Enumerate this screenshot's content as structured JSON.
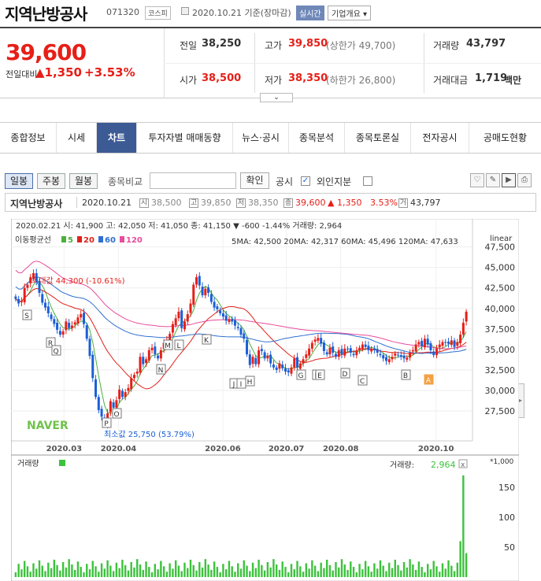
{
  "header": {
    "title": "지역난방공사",
    "code": "071320",
    "market": "코스피",
    "date_info": "2020.10.21 기준(장마감)",
    "realtime_btn": "실시간",
    "corp_btn": "기업개요 ▾"
  },
  "quote": {
    "price": "39,600",
    "prev_label": "전일대비",
    "change_amt": "▲1,350",
    "change_pct": "+3.53%",
    "prev_close_label": "전일",
    "prev_close": "38,250",
    "high_label": "고가",
    "high": "39,850",
    "upper_limit": "(상한가 49,700)",
    "volume_label": "거래량",
    "volume": "43,797",
    "open_label": "시가",
    "open": "38,500",
    "low_label": "저가",
    "low": "38,350",
    "lower_limit": "(하한가 26,800)",
    "amount_label": "거래대금",
    "amount": "1,719",
    "amount_unit": "백만"
  },
  "tabs": [
    "종합정보",
    "시세",
    "차트",
    "투자자별 매매동향",
    "뉴스·공시",
    "종목분석",
    "종목토론실",
    "전자공시",
    "공매도현황"
  ],
  "active_tab": "차트",
  "toolbar": {
    "periods": [
      "일봉",
      "주봉",
      "월봉"
    ],
    "compare_label": "종목비교",
    "ok_label": "확인",
    "disclosure_label": "공시",
    "foreign_label": "외인지분"
  },
  "summary": {
    "name": "지역난방공사",
    "date": "2020.10.21",
    "open": "38,500",
    "high": "39,850",
    "low": "38,350",
    "close": "39,600",
    "change": "▲ 1,350",
    "pct": "3.53%",
    "volume": "43,797",
    "tags": [
      "시",
      "고",
      "저",
      "종",
      "거"
    ]
  },
  "chart_info": {
    "hover_line": "2020.02.21  시: 41,900  고: 42,050  저: 41,050  종: 41,150 ▼   -600   -1.44%  거래량: 2,964",
    "ma_label": "이동평균선",
    "ma_legend": [
      "5",
      "20",
      "60",
      "120"
    ],
    "ma_values": "5MA: 42,500  20MA: 42,317  60MA: 45,496  120MA: 47,633",
    "scale": "linear",
    "max_label": "최대값 44,300 (-10.61%)",
    "min_label": "최소값 25,750 (53.79%)",
    "watermark": "NAVER",
    "volume_label": "거래량",
    "volume_value_label": "거래량:",
    "volume_value": "2,964",
    "volume_unit": "*1,000"
  },
  "colors": {
    "up": "#e61f18",
    "down": "#1a5fd8",
    "ma5": "#4caf3c",
    "ma20": "#e0221b",
    "ma60": "#2f6fd0",
    "ma120": "#e84c9c",
    "volume": "#3cc23c",
    "signal_a": "#f5a042"
  },
  "chart_data": {
    "type": "candlestick",
    "y_ticks": [
      "47,500",
      "45,000",
      "42,500",
      "40,000",
      "37,500",
      "35,000",
      "32,500",
      "30,000",
      "27,500"
    ],
    "ylim": [
      25000,
      49000
    ],
    "x_ticks": [
      "2020.03",
      "2020.04",
      "2020.06",
      "2020.07",
      "2020.08",
      "2020.10"
    ],
    "close": [
      41150,
      40600,
      40900,
      42500,
      42900,
      43800,
      44300,
      43200,
      41900,
      40700,
      40100,
      39400,
      38700,
      38100,
      37400,
      36800,
      37200,
      38400,
      37600,
      37900,
      38300,
      38900,
      39300,
      38100,
      36300,
      34200,
      31500,
      29200,
      27600,
      26800,
      25750,
      27200,
      28700,
      27900,
      28800,
      30100,
      29200,
      29800,
      30300,
      31500,
      31900,
      32300,
      34100,
      33200,
      33800,
      34900,
      35200,
      34400,
      33900,
      34900,
      35800,
      36100,
      36900,
      38100,
      38800,
      39600,
      37600,
      38400,
      39300,
      40600,
      42900,
      43800,
      42800,
      41600,
      42400,
      41900,
      40800,
      40100,
      39900,
      39400,
      39000,
      38500,
      38700,
      38400,
      37900,
      37600,
      36800,
      36300,
      34400,
      33100,
      34100,
      33200,
      34900,
      34800,
      33900,
      34200,
      33300,
      32800,
      32500,
      33300,
      32700,
      32300,
      32200,
      32800,
      33900,
      32800,
      33300,
      33800,
      34400,
      35100,
      35800,
      36200,
      36400,
      35700,
      34800,
      34400,
      35200,
      34600,
      34100,
      34900,
      34400,
      35100,
      35000,
      34600,
      34300,
      34800,
      35200,
      35600,
      35300,
      34900,
      35100,
      34900,
      34600,
      34300,
      33900,
      33600,
      33800,
      34100,
      34500,
      34300,
      34100,
      33900,
      34000,
      34600,
      34900,
      35600,
      35900,
      35400,
      36300,
      35600,
      34900,
      34300,
      35100,
      35600,
      35900,
      35800,
      35700,
      36100,
      35300,
      35900,
      36800,
      38250,
      39600
    ],
    "markers": [
      "S",
      "R",
      "Q",
      "P",
      "O",
      "N",
      "M",
      "L",
      "K",
      "J",
      "I",
      "H",
      "G",
      "F",
      "E",
      "D",
      "C",
      "B",
      "A"
    ],
    "volume_ticks": [
      "150",
      "100",
      "50"
    ],
    "volume_last": 170
  }
}
